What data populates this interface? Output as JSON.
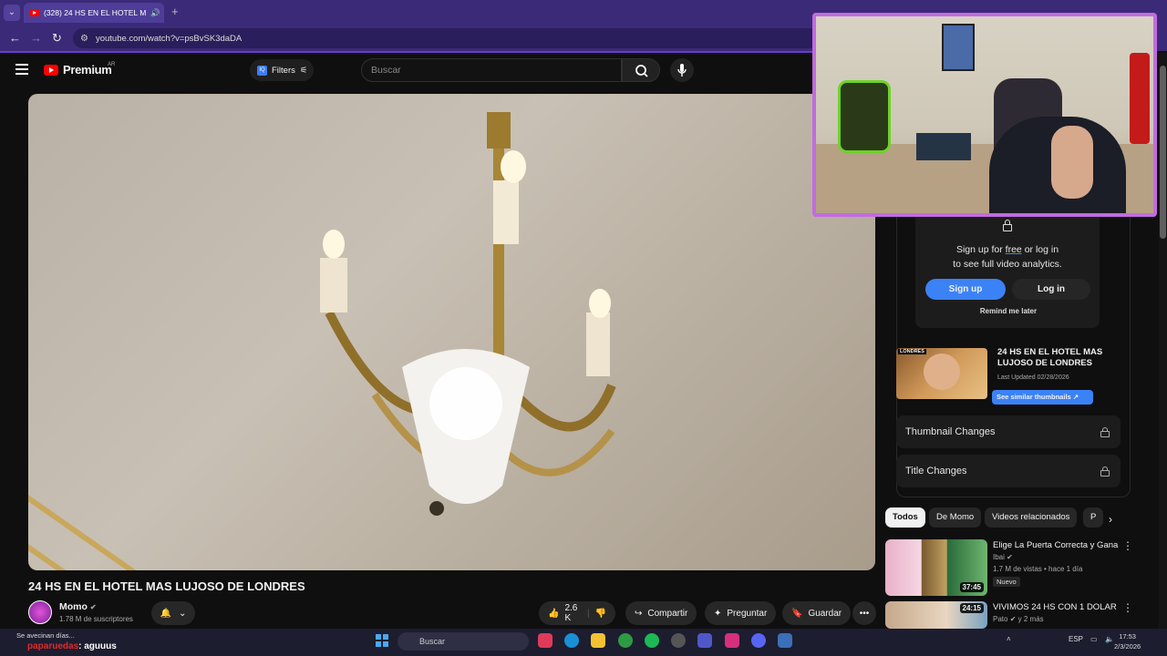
{
  "browser": {
    "tab_title": "(328) 24 HS EN EL HOTEL M",
    "url": "youtube.com/watch?v=psBvSK3daDA"
  },
  "youtube": {
    "logo": "Premium",
    "region": "AR",
    "filters_label": "Filters",
    "search_placeholder": "Buscar"
  },
  "video": {
    "title": "24 HS EN EL HOTEL MAS LUJOSO DE LONDRES",
    "channel": "Momo",
    "subscribers": "1.78 M de suscriptores",
    "likes": "2.6 K",
    "share": "Compartir",
    "ask": "Preguntar",
    "save": "Guardar"
  },
  "analytics": {
    "lock_text_1": "Sign up for",
    "lock_text_free": "free",
    "lock_text_2": "or log in",
    "lock_text_3": "to see full video analytics.",
    "signup": "Sign up",
    "login": "Log in",
    "remind": "Remind me later",
    "thumb_tag": "LONDRES",
    "card_title": "24 HS EN EL HOTEL MAS LUJOSO DE LONDRES",
    "updated": "Last Updated 02/28/2026",
    "similar": "See similar thumbnails",
    "thumbnail_changes": "Thumbnail Changes",
    "title_changes": "Title Changes"
  },
  "chips": [
    "Todos",
    "De Momo",
    "Videos relacionados",
    "P"
  ],
  "recommendations": [
    {
      "title": "Elige La Puerta Correcta y Gana",
      "channel": "Ibai",
      "meta": "1.7 M de vistas • hace 1 día",
      "badge": "Nuevo",
      "duration": "37:45"
    },
    {
      "title": "VIVIMOS 24 HS CON 1 DOLAR",
      "channel": "Pato",
      "meta": "y 2 más",
      "duration": "24:15"
    }
  ],
  "taskbar": {
    "notification": "Se avecinan días...",
    "user_red": "paparuedas",
    "user_msg": ": aguuus",
    "search": "Buscar",
    "lang": "ESP",
    "time": "17:53",
    "date": "2/3/2026"
  },
  "colors": {
    "browser_chrome": "#3b2a78",
    "yt_red": "#ff0000",
    "accent_blue": "#3b82f6",
    "webcam_border": "#c26be0"
  }
}
